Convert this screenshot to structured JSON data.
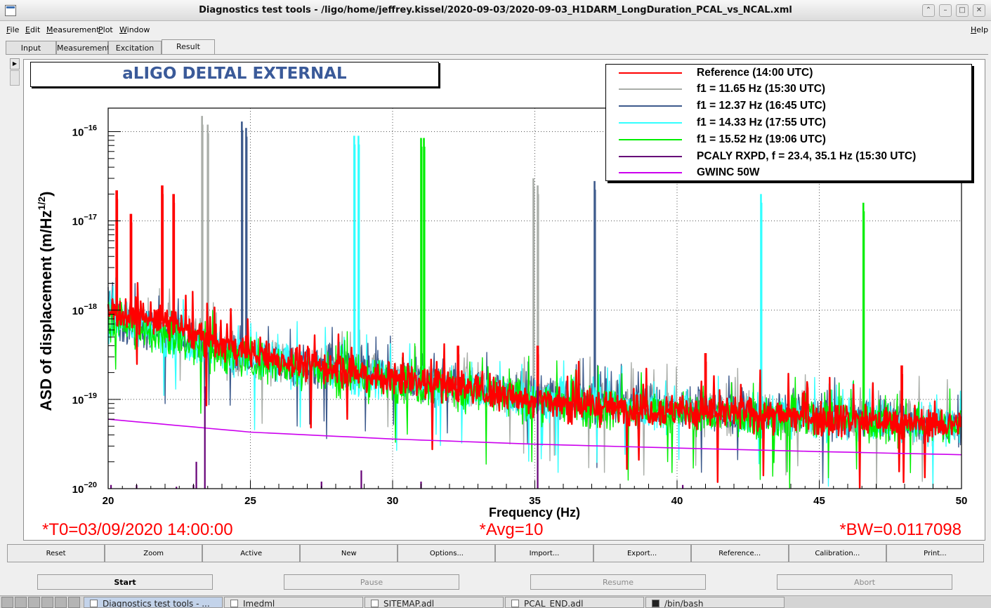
{
  "window": {
    "title": "Diagnostics test tools - /ligo/home/jeffrey.kissel/2020-09-03/2020-09-03_H1DARM_LongDuration_PCAL_vs_NCAL.xml",
    "controls": [
      "⌃",
      "–",
      "□",
      "✕"
    ]
  },
  "menu": {
    "file": "File",
    "edit": "Edit",
    "measurement": "Measurement",
    "plot": "Plot",
    "window": "Window",
    "help": "Help"
  },
  "tabs": [
    "Input",
    "Measurement",
    "Excitation",
    "Result"
  ],
  "plot": {
    "title": "aLIGO DELTAL EXTERNAL",
    "xlabel": "Frequency (Hz)",
    "ylabel": "ASD of displacement (m/Hz",
    "ylabel_sup": "1/2",
    "ylabel_end": ")",
    "footer": {
      "t0": "*T0=03/09/2020 14:00:00",
      "avg": "*Avg=10",
      "bw": "*BW=0.0117098"
    }
  },
  "chart_data": {
    "type": "line",
    "title": "aLIGO DELTAL EXTERNAL",
    "xlabel": "Frequency (Hz)",
    "ylabel": "ASD of displacement (m/Hz^1/2)",
    "xlim": [
      20,
      50
    ],
    "ylim": [
      1e-20,
      2e-16
    ],
    "yscale": "log",
    "grid": true,
    "legend_position": "top-right",
    "x_ticks": [
      "20",
      "25",
      "30",
      "35",
      "40",
      "45",
      "50"
    ],
    "y_ticks": [
      {
        "value": 1e-16,
        "mant": "10",
        "exp": "−16"
      },
      {
        "value": 1e-17,
        "mant": "10",
        "exp": "−17"
      },
      {
        "value": 1e-18,
        "mant": "10",
        "exp": "−18"
      },
      {
        "value": 1e-19,
        "mant": "10",
        "exp": "−19"
      },
      {
        "value": 1e-20,
        "mant": "10",
        "exp": "−20"
      }
    ],
    "series": [
      {
        "name": "Reference (14:00 UTC)",
        "color": "#ff0000",
        "width": 2.4,
        "x": [
          20,
          22,
          24,
          26,
          28,
          30,
          32,
          34,
          36,
          38,
          40,
          42,
          44,
          46,
          48,
          50
        ],
        "y": [
          1e-18,
          7.5e-19,
          4e-19,
          2.8e-19,
          2.2e-19,
          1.7e-19,
          1.5e-19,
          1.1e-19,
          9e-20,
          8e-20,
          7.5e-20,
          7e-20,
          6.5e-20,
          6e-20,
          5.5e-20,
          5.2e-20
        ],
        "peaks": [
          [
            20.3,
            2.2e-17
          ],
          [
            20.8,
            1.2e-17
          ],
          [
            21.9,
            2.5e-17
          ],
          [
            22.3,
            2e-17
          ],
          [
            32.3,
            4e-19
          ],
          [
            35.1,
            4e-19
          ],
          [
            41.0,
            3.3e-19
          ],
          [
            47.9,
            2.4e-19
          ]
        ]
      },
      {
        "name": "f1 = 11.65 Hz (15:30 UTC)",
        "color": "#a9ada8",
        "width": 1.4,
        "x": [
          20,
          25,
          30,
          35,
          40,
          45,
          50
        ],
        "y": [
          9e-19,
          3e-19,
          1.8e-19,
          1.1e-19,
          8e-20,
          6.5e-20,
          5.5e-20
        ],
        "peaks": [
          [
            23.3,
            1.5e-16
          ],
          [
            23.5,
            1.2e-16
          ],
          [
            34.95,
            3e-17
          ],
          [
            35.1,
            2.5e-17
          ]
        ]
      },
      {
        "name": "f1 = 12.37 Hz (16:45 UTC)",
        "color": "#3d5a8c",
        "width": 1.4,
        "x": [
          20,
          25,
          30,
          35,
          40,
          45,
          50
        ],
        "y": [
          8.5e-19,
          3e-19,
          1.8e-19,
          1.1e-19,
          8e-20,
          6.5e-20,
          5.5e-20
        ],
        "peaks": [
          [
            24.7,
            1.3e-16
          ],
          [
            24.85,
            1.1e-16
          ],
          [
            37.1,
            2.8e-17
          ]
        ]
      },
      {
        "name": "f1 = 14.33 Hz (17:55 UTC)",
        "color": "#33ffff",
        "width": 1.4,
        "x": [
          20,
          25,
          30,
          35,
          40,
          45,
          50
        ],
        "y": [
          8e-19,
          2.8e-19,
          1.7e-19,
          1e-19,
          7.5e-20,
          6e-20,
          5e-20
        ],
        "peaks": [
          [
            28.65,
            9e-17
          ],
          [
            28.8,
            9e-17
          ],
          [
            42.95,
            2e-17
          ]
        ]
      },
      {
        "name": "f1 = 15.52 Hz (19:06 UTC)",
        "color": "#00ee00",
        "width": 1.4,
        "x": [
          20,
          25,
          30,
          35,
          40,
          45,
          50
        ],
        "y": [
          8e-19,
          2.7e-19,
          1.6e-19,
          9.5e-20,
          7e-20,
          6e-20,
          5e-20
        ],
        "peaks": [
          [
            31.0,
            8.5e-17
          ],
          [
            31.1,
            8.5e-17
          ],
          [
            46.55,
            1.6e-17
          ]
        ]
      },
      {
        "name": "PCALY RXPD, f = 23.4, 35.1 Hz (15:30 UTC)",
        "color": "#660077",
        "width": 1.6,
        "x": [
          20,
          50
        ],
        "y": [
          1e-20,
          1e-20
        ],
        "peaks": [
          [
            20.1,
            1.1e-20
          ],
          [
            21.0,
            1.1e-20
          ],
          [
            22.4,
            1.05e-20
          ],
          [
            23.0,
            1.1e-20
          ],
          [
            23.1,
            2e-20
          ],
          [
            23.4,
            1.4e-19
          ],
          [
            27.5,
            1.2e-20
          ],
          [
            28.9,
            1.6e-20
          ],
          [
            31.0,
            1.2e-20
          ],
          [
            35.1,
            1.4e-19
          ],
          [
            40.2,
            1.1e-20
          ]
        ]
      },
      {
        "name": "GWINC 50W",
        "color": "#cc00ee",
        "width": 1.6,
        "x": [
          20,
          25,
          30,
          35,
          40,
          45,
          50
        ],
        "y": [
          6e-20,
          4.3e-20,
          3.6e-20,
          3.15e-20,
          2.85e-20,
          2.6e-20,
          2.4e-20
        ],
        "peaks": []
      }
    ]
  },
  "buttons": {
    "row1": [
      "Reset",
      "Zoom",
      "Active",
      "New",
      "Options...",
      "Import...",
      "Export...",
      "Reference...",
      "Calibration...",
      "Print..."
    ],
    "start": "Start",
    "pause": "Pause",
    "resume": "Resume",
    "abort": "Abort"
  },
  "taskbar": {
    "items": [
      "Diagnostics test tools - ...",
      "Imedml",
      "SITEMAP.adl",
      "PCAL_END.adl",
      "/bin/bash"
    ]
  }
}
